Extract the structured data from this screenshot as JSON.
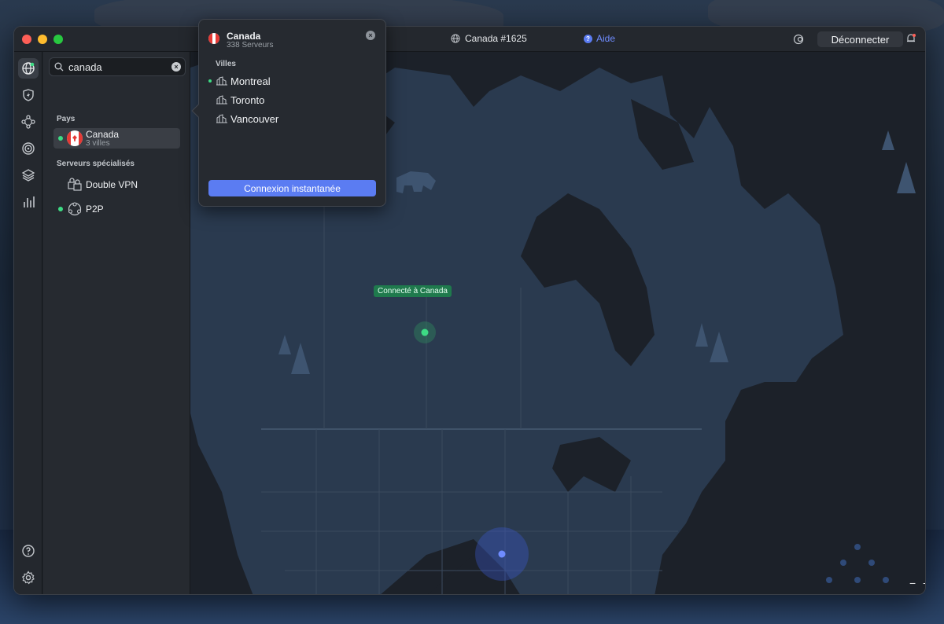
{
  "titlebar": {
    "server_name": "Canada #1625",
    "help_label": "Aide",
    "disconnect_label": "Déconnecter"
  },
  "search": {
    "value": "canada",
    "placeholder": ""
  },
  "sidebar": {
    "section_countries": "Pays",
    "country": {
      "name": "Canada",
      "subtitle": "3 villes",
      "connected": true
    },
    "section_specialty": "Serveurs spécialisés",
    "specialty": [
      {
        "label": "Double VPN"
      },
      {
        "label": "P2P"
      }
    ]
  },
  "popup": {
    "country": "Canada",
    "servers": "338 Serveurs",
    "section_cities": "Villes",
    "cities": [
      "Montreal",
      "Toronto",
      "Vancouver"
    ],
    "active_city": "Montreal",
    "quick_connect_label": "Connexion instantanée"
  },
  "map": {
    "connected_label": "Connecté à Canada"
  },
  "zoom": {
    "out": "−",
    "in": "+"
  },
  "colors": {
    "accent": "#5b7cf2",
    "connected": "#3ddc84",
    "map_land": "#2a3a4f",
    "map_water": "#1c2129"
  }
}
